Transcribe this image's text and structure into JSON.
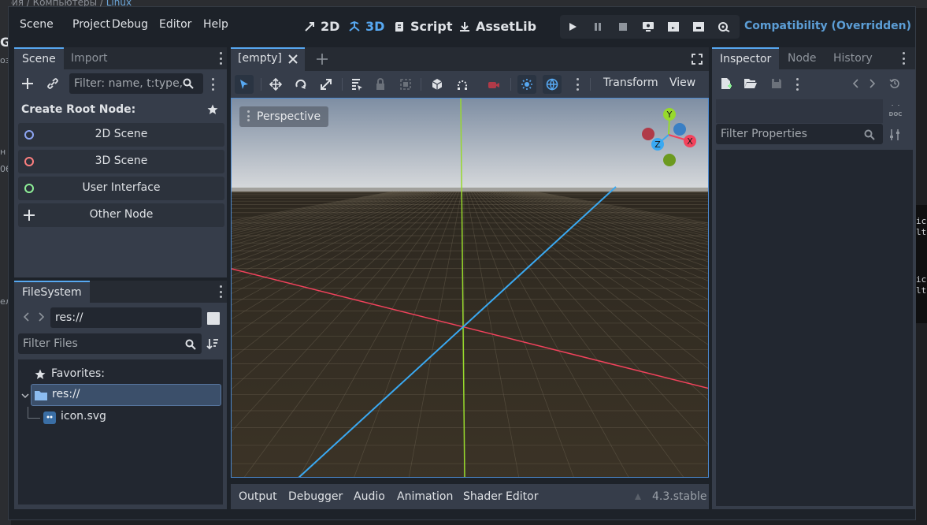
{
  "background": {
    "breadcrumb_a": "ория / Компьютеры / ",
    "breadcrumb_b": "Linux",
    "right_fragments": [
      "ic",
      "lt",
      "ic",
      "lt"
    ],
    "left_fragments": [
      "G",
      "оз,",
      "н",
      "06",
      "ел"
    ]
  },
  "menu": [
    "Scene",
    "Project",
    "Debug",
    "Editor",
    "Help"
  ],
  "workspaces": {
    "ws_2d": "2D",
    "ws_3d": "3D",
    "ws_script": "Script",
    "ws_assetlib": "AssetLib",
    "active": "3D"
  },
  "renderer": "Compatibility (Overridden)",
  "scene_dock": {
    "tabs": [
      "Scene",
      "Import"
    ],
    "filter_placeholder": "Filter: name, t:type,",
    "create_root_label": "Create Root Node:",
    "node_buttons": [
      {
        "label": "2D Scene",
        "color": "#8da5f3"
      },
      {
        "label": "3D Scene",
        "color": "#fc7f7f"
      },
      {
        "label": "User Interface",
        "color": "#8eef97"
      },
      {
        "label": "Other Node",
        "color": "#dfe2e6"
      }
    ]
  },
  "filesystem_dock": {
    "tab": "FileSystem",
    "path_value": "res://",
    "filter_placeholder": "Filter Files",
    "favorites_label": "Favorites:",
    "root_label": "res://",
    "file_label": "icon.svg"
  },
  "editor_tabs": {
    "scene_tab": "[empty]"
  },
  "viewport_toolbar": {
    "transform_label": "Transform",
    "view_label": "View"
  },
  "viewport": {
    "perspective_label": "Perspective",
    "gizmo_labels": {
      "x": "X",
      "y": "Y",
      "z": "Z"
    },
    "axis_colors": {
      "x": "#f2425c",
      "y": "#97d92c",
      "z": "#3aa9f2"
    },
    "sky_top": "#7e8ea3",
    "horizon": "#d9dbdd",
    "ground": "#3b3326"
  },
  "bottom_panel": {
    "tabs": [
      "Output",
      "Debugger",
      "Audio",
      "Animation",
      "Shader Editor"
    ],
    "version": "4.3.stable"
  },
  "inspector_dock": {
    "tabs": [
      "Inspector",
      "Node",
      "History"
    ],
    "filter_placeholder": "Filter Properties"
  },
  "colors": {
    "accent": "#57a8f1",
    "window_bg": "#1d2229",
    "panel_bg": "#363d4a"
  }
}
